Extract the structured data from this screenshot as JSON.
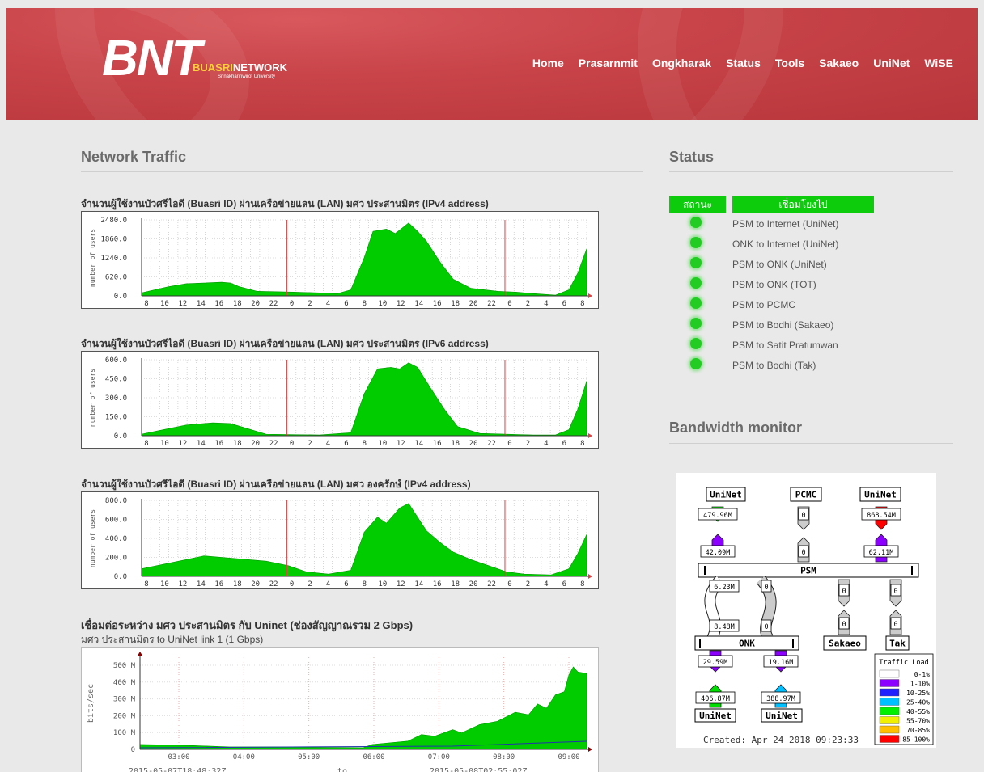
{
  "header": {
    "logo": "BNT",
    "logo_accent": "BUASRI",
    "logo_rest": "NETWORK",
    "logo_sub": "Srinakharinwirot University",
    "nav": [
      "Home",
      "Prasarnmit",
      "Ongkharak",
      "Status",
      "Tools",
      "Sakaeo",
      "UniNet",
      "WiSE"
    ]
  },
  "main": {
    "title": "Network Traffic",
    "graphs": [
      {
        "caption": "จำนวนผู้ใช้งานบัวศรีไอดี (Buasri ID) ผ่านเครือข่ายแลน (LAN) มศว ประสานมิตร  (IPv4 address)",
        "ylabel": "number of users",
        "yticks": [
          "2480.0",
          "1860.0",
          "1240.0",
          "620.0",
          "0.0"
        ]
      },
      {
        "caption": "จำนวนผู้ใช้งานบัวศรีไอดี (Buasri ID) ผ่านเครือข่ายแลน (LAN) มศว ประสานมิตร  (IPv6 address)",
        "ylabel": "number of users",
        "yticks": [
          "600.0",
          "450.0",
          "300.0",
          "150.0",
          "0.0"
        ]
      },
      {
        "caption": "จำนวนผู้ใช้งานบัวศรีไอดี (Buasri ID) ผ่านเครือข่ายแลน (LAN) มศว องครักษ์ (IPv4 address)",
        "ylabel": "number of users",
        "yticks": [
          "800.0",
          "600.0",
          "400.0",
          "200.0",
          "0.0"
        ]
      }
    ],
    "xticks": [
      "8",
      "10",
      "12",
      "14",
      "16",
      "18",
      "20",
      "22",
      "0",
      "2",
      "4",
      "6",
      "8",
      "10",
      "12",
      "14",
      "16",
      "18",
      "20",
      "22",
      "0",
      "2",
      "4",
      "6",
      "8"
    ],
    "link": {
      "caption": "เชื่อมต่อระหว่าง มศว ประสานมิตร กับ Uninet (ช่องสัญญาณรวม 2 Gbps)",
      "sub": "มศว ประสานมิตร to UniNet link 1 (1 Gbps)",
      "ylabel": "bits/sec",
      "yticks": [
        "500 M",
        "400 M",
        "300 M",
        "200 M",
        "100 M",
        "0"
      ],
      "xticks": [
        "03:00",
        "04:00",
        "05:00",
        "06:00",
        "07:00",
        "08:00",
        "09:00"
      ],
      "from": "2015-05-07T18:48:32Z",
      "to_label": "to",
      "to": "2015-05-08T02:55:02Z"
    }
  },
  "status": {
    "title": "Status",
    "headers": [
      "สถานะ",
      "เชื่อมโยงไป"
    ],
    "rows": [
      "PSM to Internet (UniNet)",
      "ONK to Internet (UniNet)",
      "PSM to ONK (UniNet)",
      "PSM to ONK (TOT)",
      "PSM to PCMC",
      "PSM to Bodhi (Sakaeo)",
      "PSM to Satit Pratumwan",
      "PSM to Bodhi (Tak)"
    ],
    "colors": {
      "header_bg": "#0ccc0c",
      "led": "#22cc22"
    }
  },
  "bandwidth": {
    "title": "Bandwidth monitor",
    "nodes": {
      "uninet_a": "UniNet",
      "pcmc": "PCMC",
      "uninet_b": "UniNet",
      "psm": "PSM",
      "onk": "ONK",
      "sakaeo": "Sakaeo",
      "tak": "Tak",
      "uninet_c": "UniNet",
      "uninet_d": "UniNet"
    },
    "labels": [
      "479.96M",
      "0",
      "868.54M",
      "42.09M",
      "0",
      "62.11M",
      "6.23M",
      "0",
      "0",
      "0",
      "8.48M",
      "0",
      "0",
      "0",
      "29.59M",
      "19.16M",
      "406.87M",
      "388.97M"
    ],
    "legend_title": "Traffic Load",
    "legend": [
      {
        "label": "0-1%",
        "color": "#ffffff"
      },
      {
        "label": "1-10%",
        "color": "#8c00ff"
      },
      {
        "label": "10-25%",
        "color": "#2020ff"
      },
      {
        "label": "25-40%",
        "color": "#00c0ff"
      },
      {
        "label": "40-55%",
        "color": "#00f000"
      },
      {
        "label": "55-70%",
        "color": "#f0f000"
      },
      {
        "label": "70-85%",
        "color": "#ffc000"
      },
      {
        "label": "85-100%",
        "color": "#ff0000"
      }
    ],
    "created": "Created: Apr 24 2018 09:23:33"
  }
}
